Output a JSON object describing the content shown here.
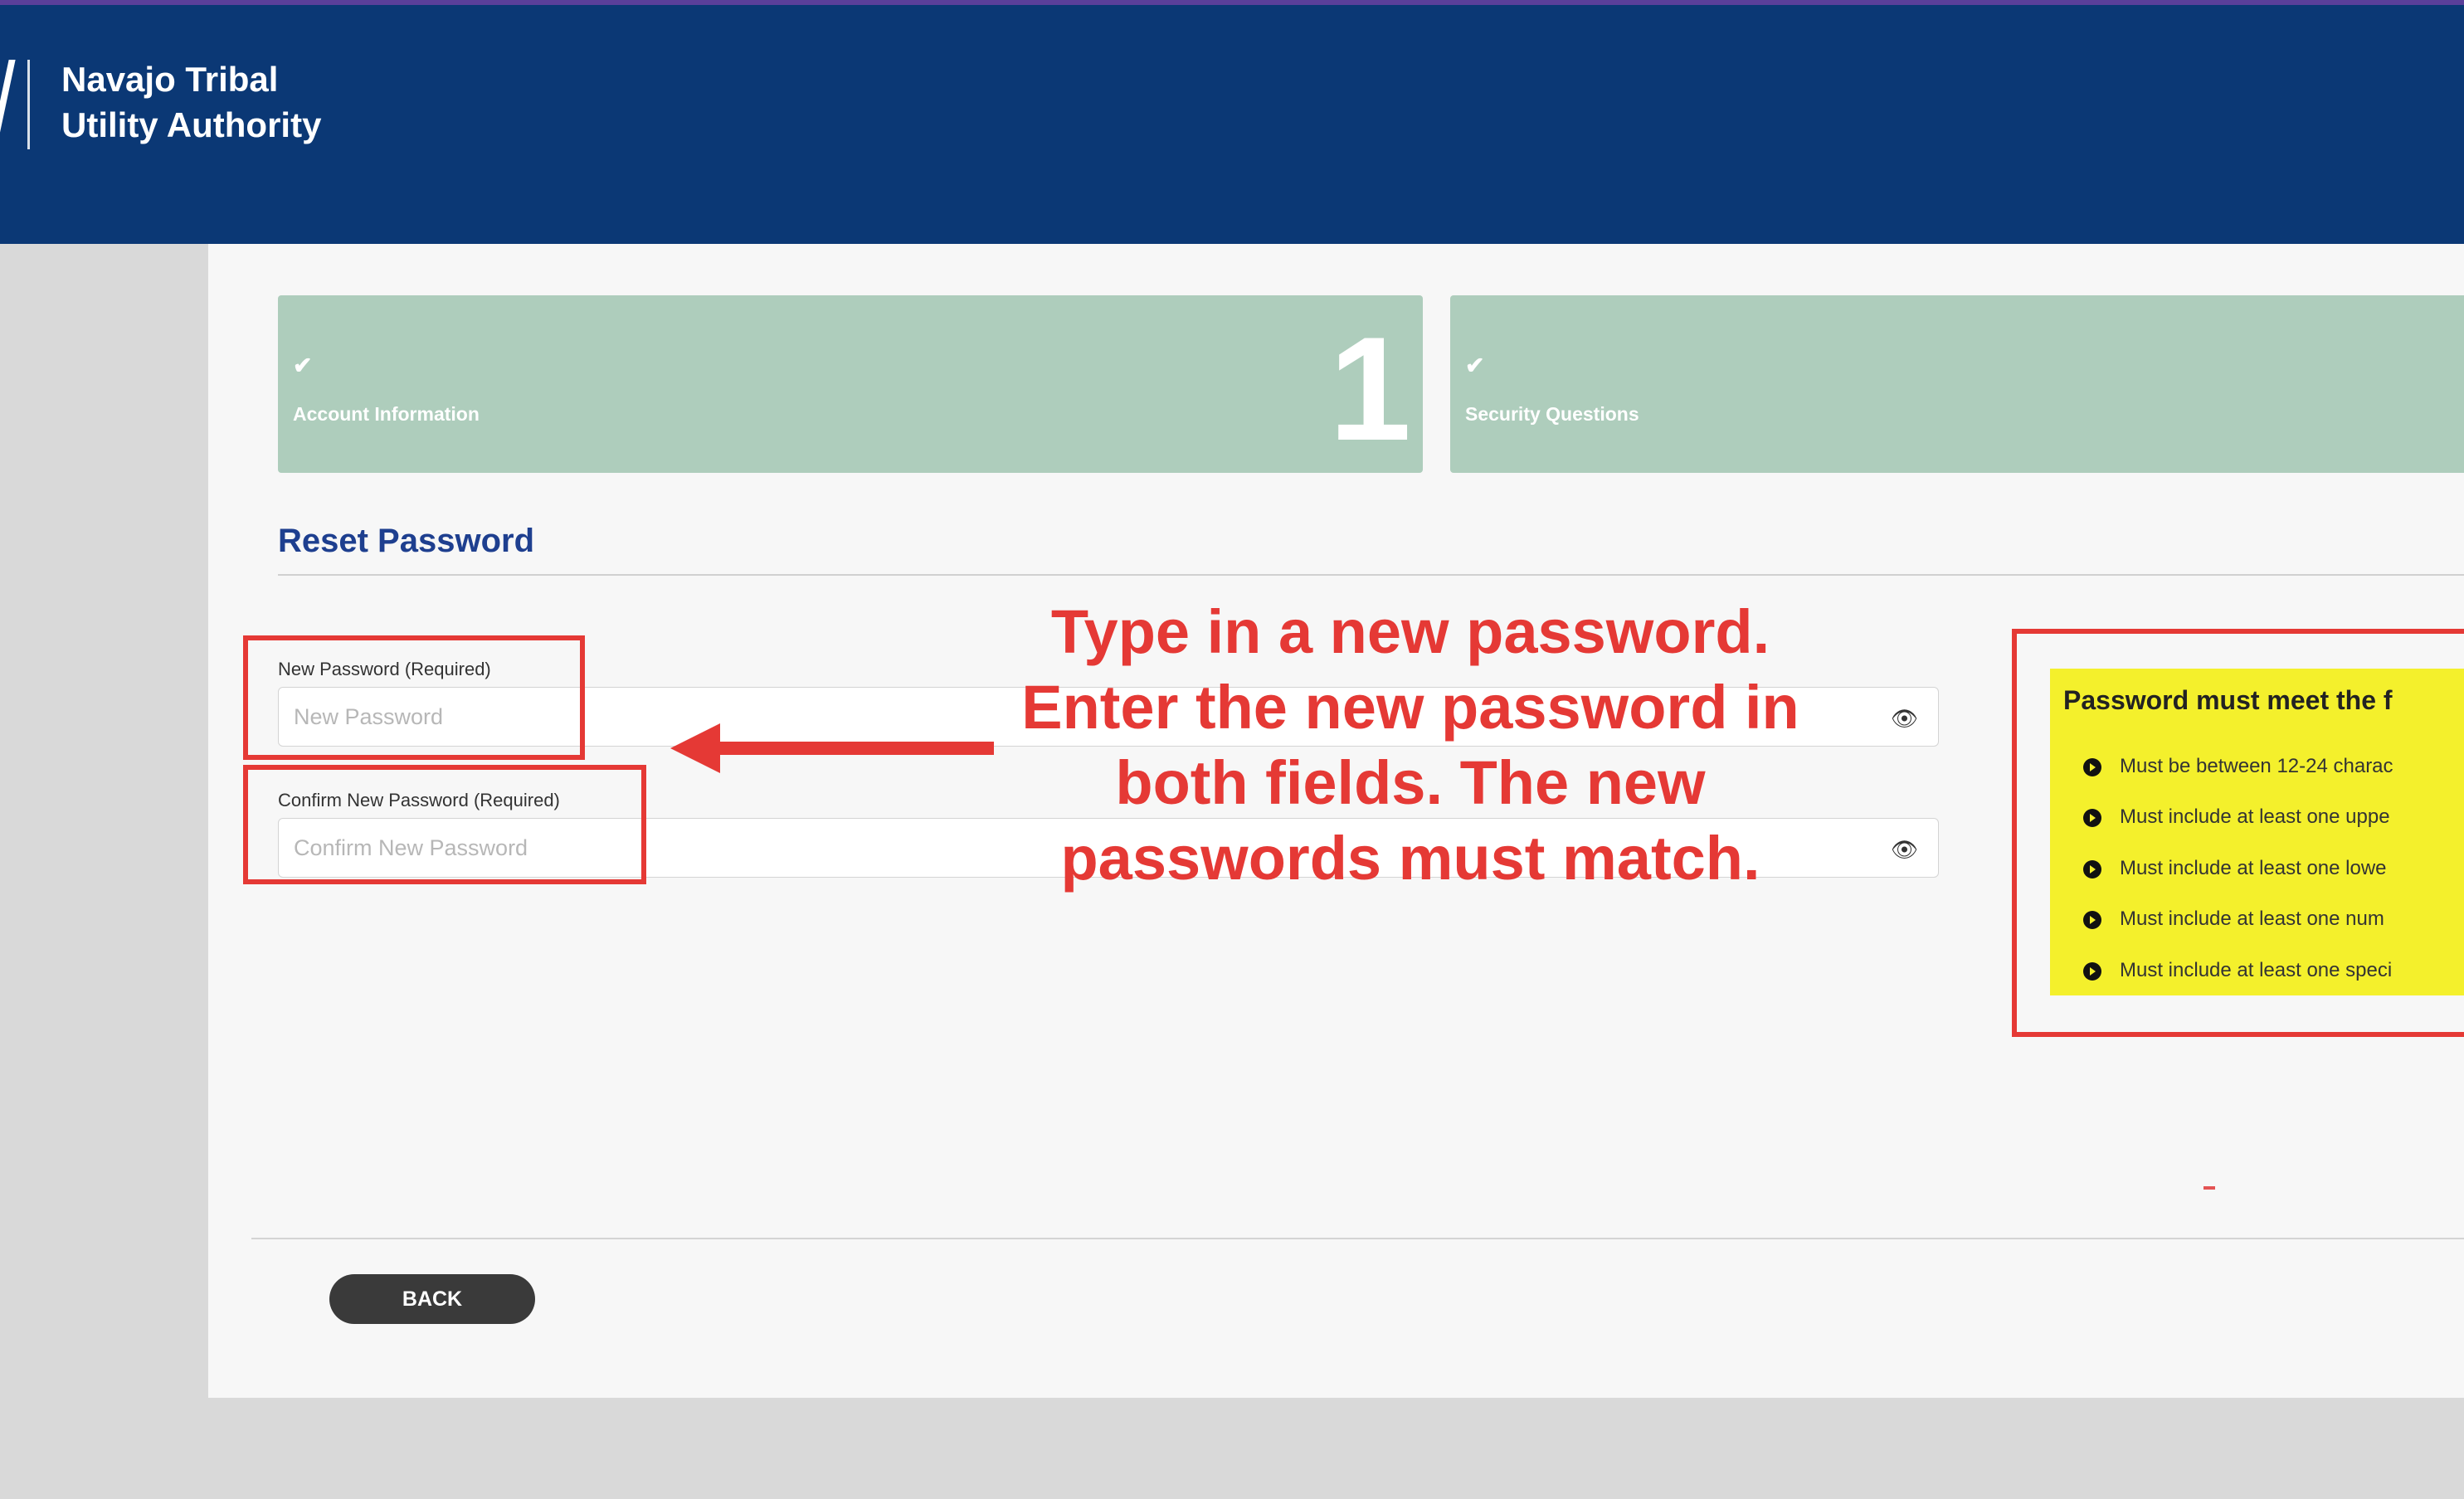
{
  "header": {
    "brand_line1": "Navajo Tribal",
    "brand_line2": "Utility Authority"
  },
  "steps": [
    {
      "label": "Account Information",
      "number": "1",
      "check": "✔"
    },
    {
      "label": "Security Questions",
      "check": "✔"
    }
  ],
  "form": {
    "title": "Reset Password",
    "new_password": {
      "label": "New Password (Required)",
      "placeholder": "New Password"
    },
    "confirm_password": {
      "label": "Confirm New Password (Required)",
      "placeholder": "Confirm New Password"
    }
  },
  "requirements": {
    "title": "Password must meet the f",
    "items": [
      "Must be between 12-24 charac",
      "Must include at least one uppe",
      "Must include at least one lowe",
      "Must include at least one num",
      "Must include at least one speci"
    ]
  },
  "footer": {
    "back_label": "BACK"
  },
  "annotation": {
    "lines": [
      "Type in a new password.",
      "Enter the new password in",
      "both fields. The new",
      "passwords must match."
    ]
  },
  "colors": {
    "header": "#0b3875",
    "step": "#aecdbc",
    "annotation": "#e53935",
    "requirements": "#f4f02c"
  }
}
